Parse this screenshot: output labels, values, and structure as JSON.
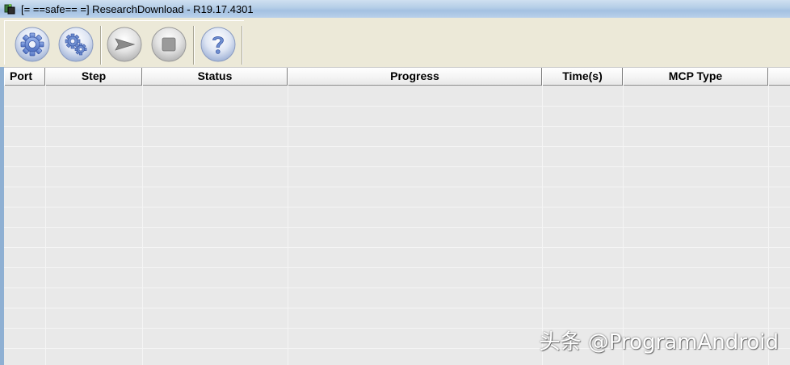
{
  "window": {
    "title": "[= ==safe== =] ResearchDownload - R19.17.4301"
  },
  "toolbar": {
    "buttons": [
      {
        "name": "load-packet-button",
        "icon": "gear-icon"
      },
      {
        "name": "settings-button",
        "icon": "gears-icon"
      },
      {
        "name": "start-download-button",
        "icon": "play-arrow-icon"
      },
      {
        "name": "stop-download-button",
        "icon": "stop-square-icon"
      },
      {
        "name": "help-button",
        "icon": "question-mark-icon"
      }
    ]
  },
  "table": {
    "columns": [
      "Port",
      "Step",
      "Status",
      "Progress",
      "Time(s)",
      "MCP Type"
    ],
    "rows": []
  },
  "watermark": {
    "text": "头条 @ProgramAndroid"
  },
  "colors": {
    "button_blue": "#6f8fd0",
    "toolbar_bg": "#ece9d8",
    "table_bg": "#e9e9e9"
  }
}
